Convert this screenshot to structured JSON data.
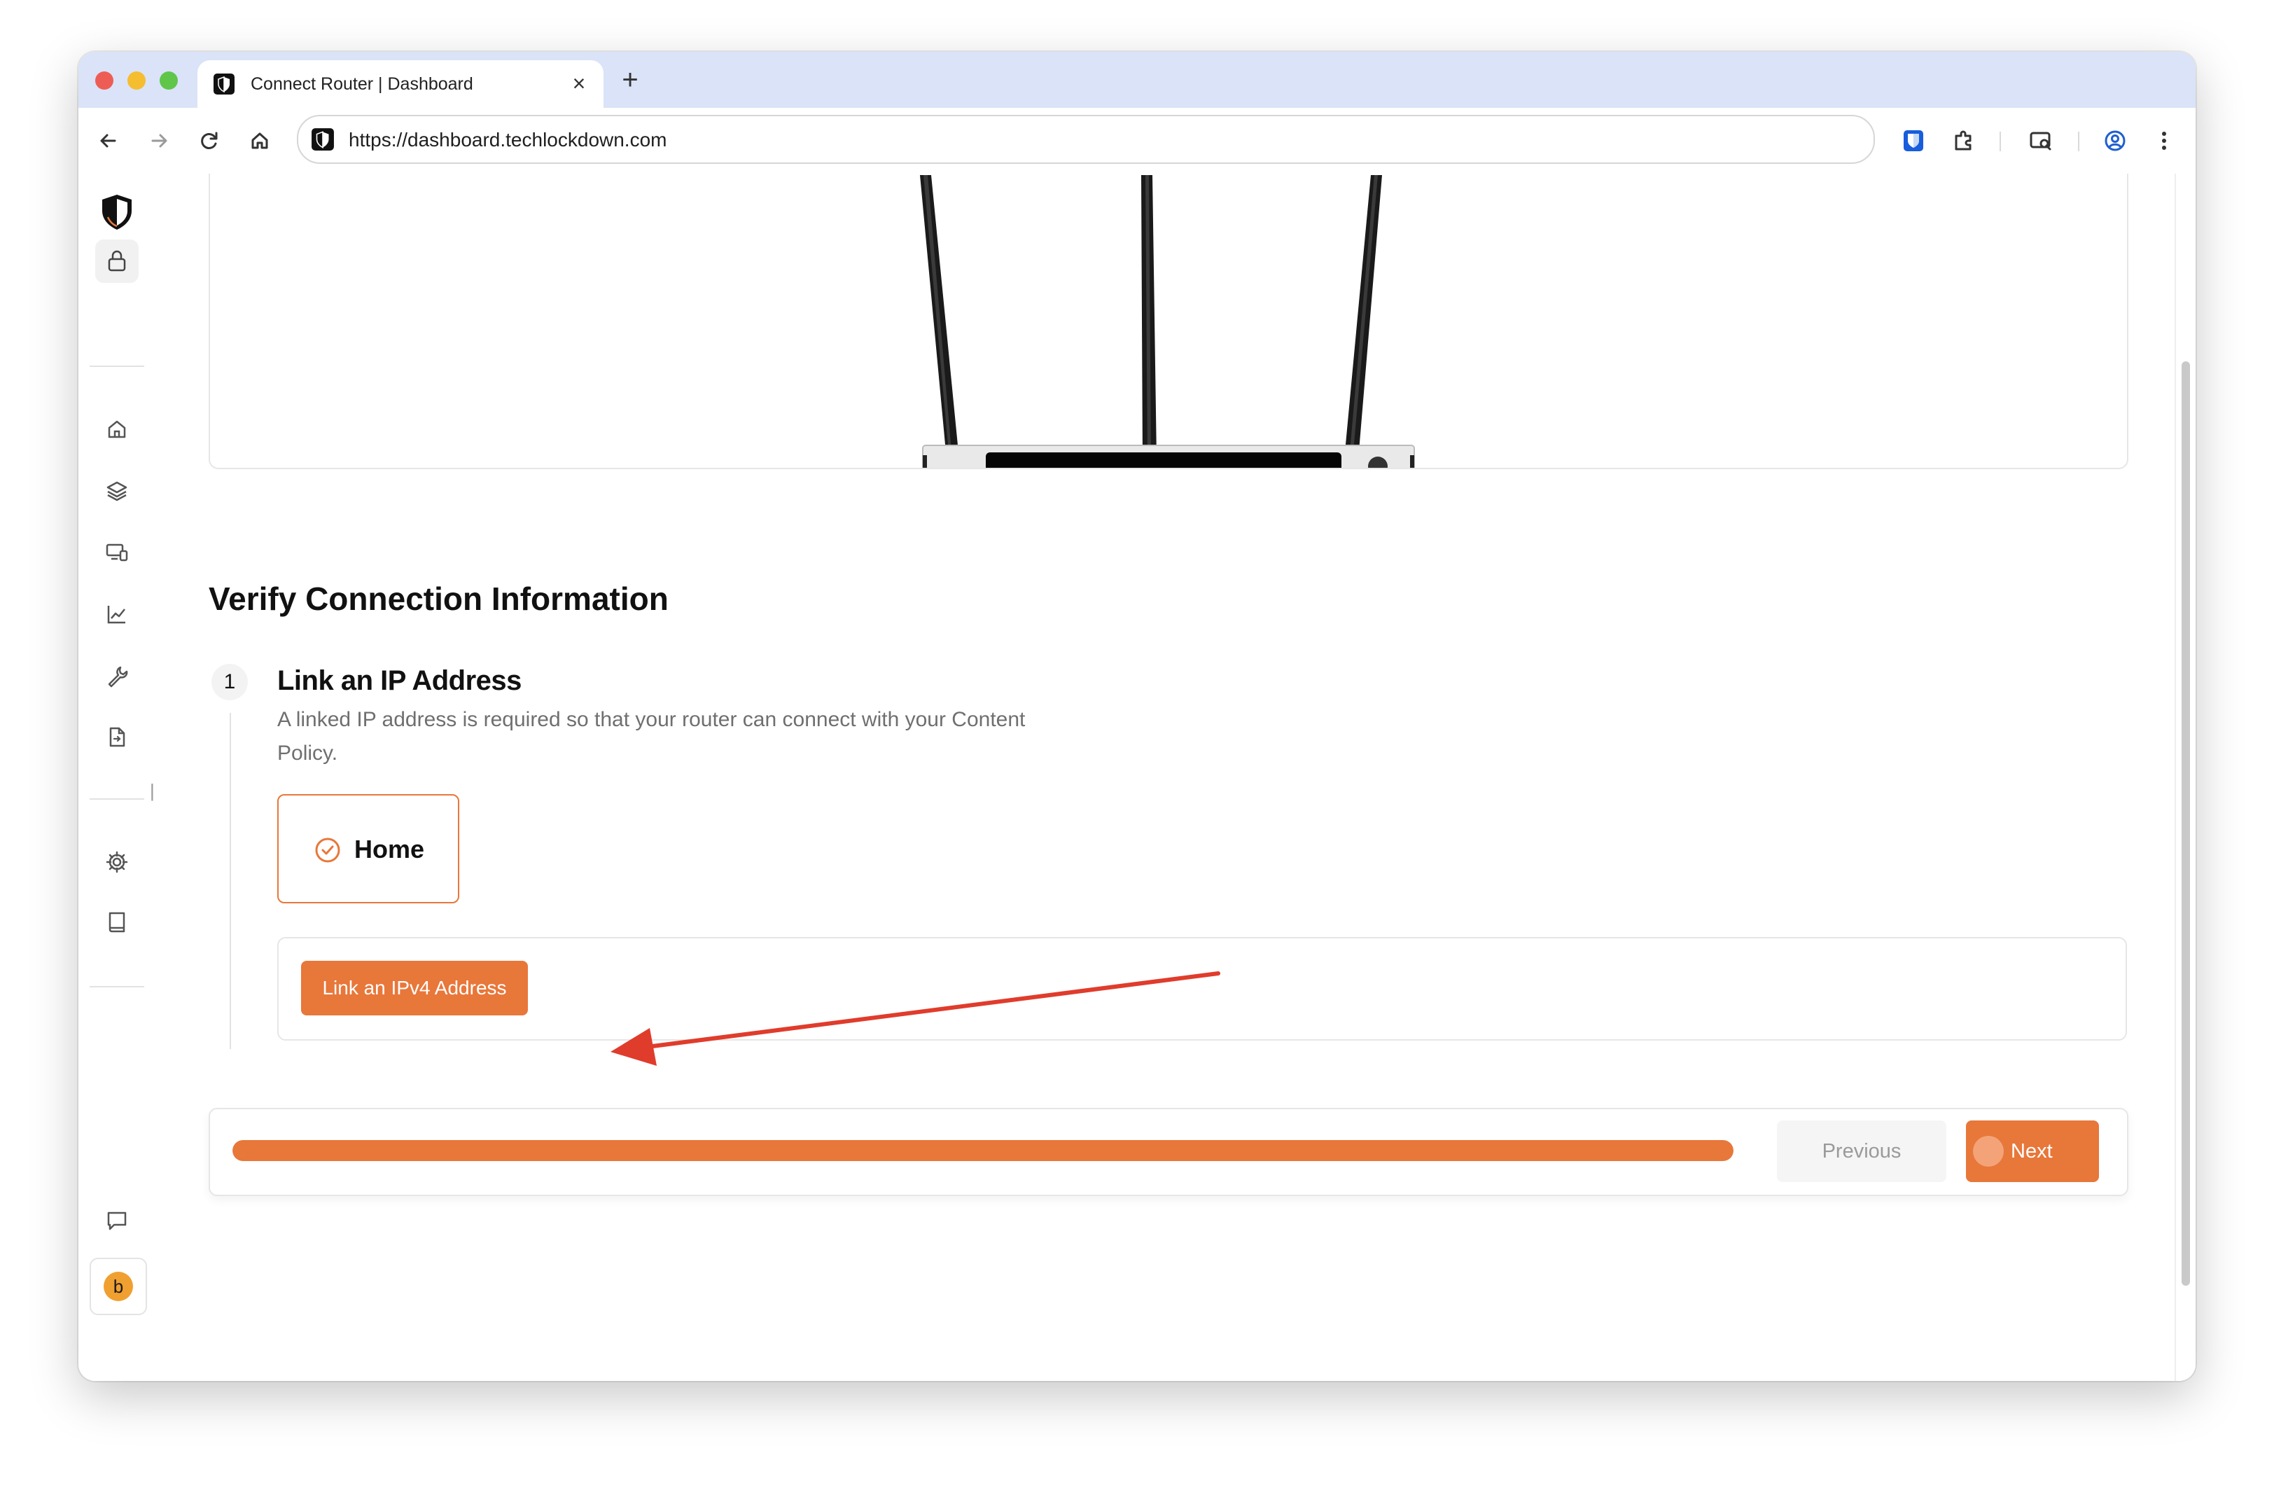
{
  "browser": {
    "tab_title": "Connect Router | Dashboard",
    "tab_close": "×",
    "new_tab": "+",
    "url": "https://dashboard.techlockdown.com"
  },
  "sidebar": {
    "avatar_letter": "b",
    "collapse_handle": "||"
  },
  "main": {
    "section_title": "Verify Connection Information",
    "step": {
      "number": "1",
      "title": "Link an IP Address",
      "description": "A linked IP address is required so that your router can connect with your Content Policy.",
      "selected_address": "Home",
      "link_button": "Link an IPv4 Address"
    },
    "footer": {
      "progress_fraction": 1.0,
      "previous_label": "Previous",
      "next_label": "Next"
    }
  },
  "colors": {
    "accent": "#e8773a",
    "annotation_arrow": "#e03c2c",
    "tab_bar": "#dae3f7"
  }
}
